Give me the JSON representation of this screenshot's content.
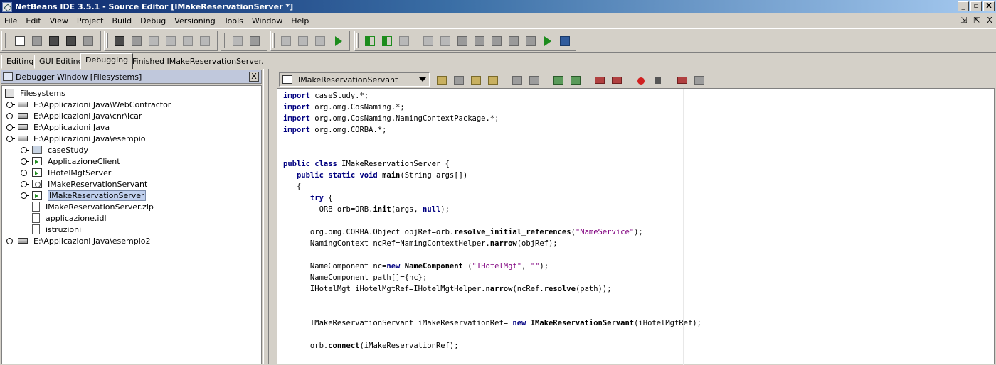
{
  "window": {
    "title": "NetBeans IDE 3.5.1 - Source Editor [IMakeReservationServer *]",
    "controls": [
      "_",
      "▫",
      "X"
    ]
  },
  "menu": [
    "File",
    "Edit",
    "View",
    "Project",
    "Build",
    "Debug",
    "Versioning",
    "Tools",
    "Window",
    "Help"
  ],
  "mdi_controls": [
    "⇲",
    "⇱",
    "X"
  ],
  "workspaces": {
    "tabs": [
      "Editing",
      "GUI Editing",
      "Debugging"
    ],
    "active": "Debugging",
    "status": "Finished IMakeReservationServer."
  },
  "left_pane": {
    "title": "Debugger Window [Filesystems]",
    "close_label": "X",
    "tree": [
      {
        "label": "Filesystems",
        "icon": "filesystems-icon"
      },
      {
        "label": "E:\\Applicazioni Java\\WebContractor",
        "icon": "drive-icon"
      },
      {
        "label": "E:\\Applicazioni Java\\cnr\\icar",
        "icon": "drive-icon"
      },
      {
        "label": "E:\\Applicazioni Java",
        "icon": "drive-icon"
      },
      {
        "label": "E:\\Applicazioni Java\\esempio",
        "icon": "drive-icon",
        "expanded": true
      },
      {
        "label": "caseStudy",
        "icon": "folder-icon"
      },
      {
        "label": "ApplicazioneClient",
        "icon": "java-class-icon"
      },
      {
        "label": "IHotelMgtServer",
        "icon": "java-class-icon"
      },
      {
        "label": "IMakeReservationServant",
        "icon": "java-interface-icon"
      },
      {
        "label": "IMakeReservationServer",
        "icon": "java-class-icon",
        "selected": true
      },
      {
        "label": "IMakeReservationServer.zip",
        "icon": "file-icon"
      },
      {
        "label": "applicazione.idl",
        "icon": "file-icon"
      },
      {
        "label": "istruzioni",
        "icon": "text-file-icon"
      },
      {
        "label": "E:\\Applicazioni Java\\esempio2",
        "icon": "drive-icon"
      }
    ]
  },
  "editor": {
    "current_file": "IMakeReservationServant",
    "code": [
      {
        "parts": [
          {
            "t": "import",
            "c": "kw"
          },
          {
            "t": " caseStudy.*;"
          }
        ]
      },
      {
        "parts": [
          {
            "t": "import",
            "c": "kw"
          },
          {
            "t": " org.omg.CosNaming.*;"
          }
        ]
      },
      {
        "parts": [
          {
            "t": "import",
            "c": "kw"
          },
          {
            "t": " org.omg.CosNaming.NamingContextPackage.*;"
          }
        ]
      },
      {
        "parts": [
          {
            "t": "import",
            "c": "kw"
          },
          {
            "t": " org.omg.CORBA.*;"
          }
        ]
      },
      {
        "parts": []
      },
      {
        "parts": []
      },
      {
        "parts": [
          {
            "t": "public class",
            "c": "kw"
          },
          {
            "t": " IMakeReservationServer {"
          }
        ]
      },
      {
        "parts": [
          {
            "t": "   "
          },
          {
            "t": "public static void",
            "c": "kw"
          },
          {
            "t": " "
          },
          {
            "t": "main",
            "c": "bd"
          },
          {
            "t": "(String args[])"
          }
        ]
      },
      {
        "parts": [
          {
            "t": "   {"
          }
        ]
      },
      {
        "parts": [
          {
            "t": "      "
          },
          {
            "t": "try",
            "c": "kw"
          },
          {
            "t": " {"
          }
        ]
      },
      {
        "parts": [
          {
            "t": "        ORB orb=ORB."
          },
          {
            "t": "init",
            "c": "bd"
          },
          {
            "t": "(args, "
          },
          {
            "t": "null",
            "c": "kw"
          },
          {
            "t": ");"
          }
        ]
      },
      {
        "parts": []
      },
      {
        "parts": [
          {
            "t": "      org.omg.CORBA.Object objRef=orb."
          },
          {
            "t": "resolve_initial_references",
            "c": "bd"
          },
          {
            "t": "("
          },
          {
            "t": "\"NameService\"",
            "c": "str"
          },
          {
            "t": ");"
          }
        ]
      },
      {
        "parts": [
          {
            "t": "      NamingContext ncRef=NamingContextHelper."
          },
          {
            "t": "narrow",
            "c": "bd"
          },
          {
            "t": "(objRef);"
          }
        ]
      },
      {
        "parts": []
      },
      {
        "parts": [
          {
            "t": "      NameComponent nc="
          },
          {
            "t": "new",
            "c": "kw"
          },
          {
            "t": " "
          },
          {
            "t": "NameComponent",
            "c": "bd"
          },
          {
            "t": " ("
          },
          {
            "t": "\"IHotelMgt\"",
            "c": "str"
          },
          {
            "t": ", "
          },
          {
            "t": "\"\"",
            "c": "str"
          },
          {
            "t": ");"
          }
        ]
      },
      {
        "parts": [
          {
            "t": "      NameComponent path[]={nc};"
          }
        ]
      },
      {
        "parts": [
          {
            "t": "      IHotelMgt iHotelMgtRef=IHotelMgtHelper."
          },
          {
            "t": "narrow",
            "c": "bd"
          },
          {
            "t": "(ncRef."
          },
          {
            "t": "resolve",
            "c": "bd"
          },
          {
            "t": "(path));"
          }
        ]
      },
      {
        "parts": []
      },
      {
        "parts": []
      },
      {
        "parts": [
          {
            "t": "      IMakeReservationServant iMakeReservationRef= "
          },
          {
            "t": "new",
            "c": "kw"
          },
          {
            "t": " "
          },
          {
            "t": "IMakeReservationServant",
            "c": "bd"
          },
          {
            "t": "(iHotelMgtRef);"
          }
        ]
      },
      {
        "parts": []
      },
      {
        "parts": [
          {
            "t": "      orb."
          },
          {
            "t": "connect",
            "c": "bd"
          },
          {
            "t": "(iMakeReservationRef);"
          }
        ]
      }
    ]
  },
  "colors": {
    "title_gradient_start": "#0a246a",
    "keyword": "#000080",
    "string": "#80007f",
    "selection": "#c0d0ee"
  }
}
